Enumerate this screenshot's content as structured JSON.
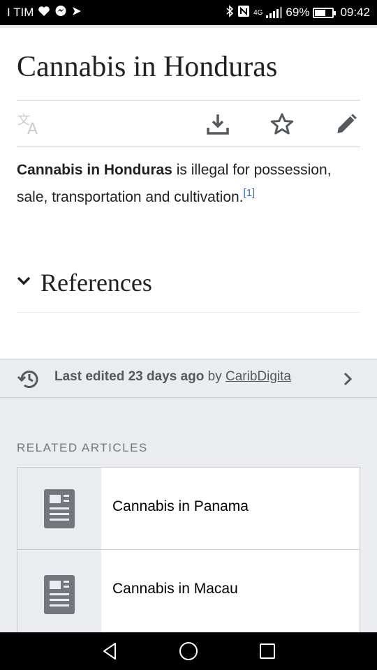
{
  "status_bar": {
    "carrier": "I TIM",
    "battery_text": "69%",
    "battery_level": 0.69,
    "network": "4G",
    "time": "09:42",
    "icons": [
      "heart-icon",
      "messenger-icon",
      "app-icon",
      "bluetooth-icon",
      "nfc-icon",
      "signal-icon",
      "battery-icon"
    ]
  },
  "article": {
    "title": "Cannabis in Honduras",
    "lead_bold": "Cannabis in Honduras",
    "lead_rest": " is illegal for possession, sale, transportation and cultivation.",
    "ref_marker": "[1]",
    "references_heading": "References"
  },
  "toolbar": {
    "icons": [
      "translate-icon",
      "download-icon",
      "star-icon",
      "edit-icon"
    ]
  },
  "last_edited": {
    "prefix": "Last edited 23 days ago",
    "by": " by ",
    "user": "CaribDigita"
  },
  "related": {
    "heading": "RELATED ARTICLES",
    "items": [
      {
        "title": "Cannabis in Panama"
      },
      {
        "title": "Cannabis in Macau"
      }
    ]
  },
  "colors": {
    "link": "#3366cc",
    "footer_bg": "#eaecf0",
    "border": "#c8ccd1"
  }
}
